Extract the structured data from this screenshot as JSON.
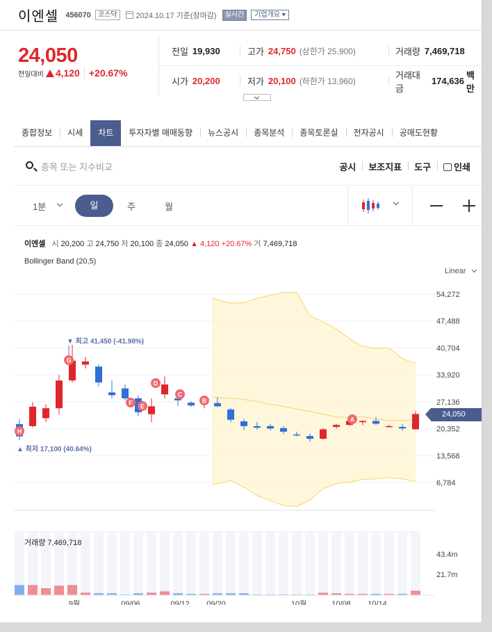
{
  "header": {
    "name": "이엔셀",
    "code": "456070",
    "market": "코스닥",
    "date": "2024.10.17 기준(장마감)",
    "realtime": "실시간",
    "company_info": "기업개요"
  },
  "summary": {
    "price": "24,050",
    "change_label": "전일대비",
    "change": "4,120",
    "change_pct": "+20.67%",
    "prev_close_label": "전일",
    "prev_close": "19,930",
    "high_label": "고가",
    "high": "24,750",
    "upper_limit": "(상한가 25,900)",
    "volume_label": "거래량",
    "volume": "7,469,718",
    "open_label": "시가",
    "open": "20,200",
    "low_label": "저가",
    "low": "20,100",
    "lower_limit": "(하한가 13,960)",
    "turnover_label": "거래대금",
    "turnover": "174,636",
    "turnover_unit": "백만"
  },
  "tabs": [
    "종합정보",
    "시세",
    "차트",
    "투자자별 매매동향",
    "뉴스공시",
    "종목분석",
    "종목토론실",
    "전자공시",
    "공매도현황"
  ],
  "active_tab": "차트",
  "search": {
    "placeholder": "종목 또는 지수비교",
    "tools": [
      "공시",
      "보조지표",
      "도구",
      "인쇄"
    ]
  },
  "periods": {
    "minute": "1분",
    "day": "일",
    "week": "주",
    "month": "월"
  },
  "legend": {
    "name": "이엔셀",
    "open_label": "시",
    "open": "20,200",
    "high_label": "고",
    "high": "24,750",
    "low_label": "저",
    "low": "20,100",
    "close_label": "종",
    "close": "24,050",
    "change": "▲ 4,120 +20.67%",
    "volume_label": "거",
    "volume": "7,469,718",
    "indicator": "Bollinger Band (20,5)",
    "scale": "Linear"
  },
  "chart_data": {
    "type": "candlestick",
    "y_ticks": [
      "54,272",
      "47,488",
      "40,704",
      "33,920",
      "27,136",
      "20,352",
      "13,568",
      "6,784"
    ],
    "x_ticks": [
      "9월",
      "09/06",
      "09/12",
      "09/20",
      "10월",
      "10/08",
      "10/14"
    ],
    "current_price": "24,050",
    "annotations": {
      "max": "▼ 최고 41,450 (-41.98%)",
      "min": "▲ 최저 17,100 (40.64%)"
    },
    "markers": [
      "A",
      "B",
      "C",
      "D",
      "E",
      "F",
      "G",
      "H"
    ],
    "volume_label": "거래량 7,469,718",
    "volume_ticks": [
      "43.4m",
      "21.7m"
    ],
    "candles": [
      {
        "o": 21500,
        "h": 22800,
        "l": 17500,
        "c": 18400
      },
      {
        "o": 21000,
        "h": 27000,
        "l": 20700,
        "c": 25900
      },
      {
        "o": 23000,
        "h": 26500,
        "l": 22000,
        "c": 25500
      },
      {
        "o": 25500,
        "h": 33900,
        "l": 24000,
        "c": 32500
      },
      {
        "o": 32500,
        "h": 41450,
        "l": 32000,
        "c": 37500
      },
      {
        "o": 36500,
        "h": 38500,
        "l": 35500,
        "c": 37300
      },
      {
        "o": 36000,
        "h": 36500,
        "l": 31000,
        "c": 32000
      },
      {
        "o": 29500,
        "h": 32500,
        "l": 28000,
        "c": 28800
      },
      {
        "o": 30500,
        "h": 31500,
        "l": 27500,
        "c": 28000
      },
      {
        "o": 28000,
        "h": 28700,
        "l": 23500,
        "c": 24500
      },
      {
        "o": 24000,
        "h": 28000,
        "l": 22000,
        "c": 26000
      },
      {
        "o": 29000,
        "h": 33500,
        "l": 28000,
        "c": 31500
      },
      {
        "o": 28000,
        "h": 28700,
        "l": 26000,
        "c": 27500
      },
      {
        "o": 26900,
        "h": 27300,
        "l": 25800,
        "c": 26200
      },
      {
        "o": 26500,
        "h": 27500,
        "l": 25500,
        "c": 26800
      },
      {
        "o": 26800,
        "h": 28300,
        "l": 25800,
        "c": 26000
      },
      {
        "o": 25200,
        "h": 25600,
        "l": 22000,
        "c": 22600
      },
      {
        "o": 22200,
        "h": 22800,
        "l": 20000,
        "c": 21000
      },
      {
        "o": 21000,
        "h": 22000,
        "l": 20100,
        "c": 20600
      },
      {
        "o": 21000,
        "h": 21600,
        "l": 19900,
        "c": 20400
      },
      {
        "o": 20500,
        "h": 21000,
        "l": 19000,
        "c": 19600
      },
      {
        "o": 18900,
        "h": 19600,
        "l": 18400,
        "c": 18700
      },
      {
        "o": 18500,
        "h": 19100,
        "l": 17100,
        "c": 17800
      },
      {
        "o": 17800,
        "h": 20500,
        "l": 17600,
        "c": 20200
      },
      {
        "o": 20800,
        "h": 21600,
        "l": 20300,
        "c": 21300
      },
      {
        "o": 21300,
        "h": 22600,
        "l": 21000,
        "c": 22300
      },
      {
        "o": 22000,
        "h": 22500,
        "l": 21200,
        "c": 22300
      },
      {
        "o": 22300,
        "h": 23300,
        "l": 21300,
        "c": 21600
      },
      {
        "o": 20800,
        "h": 21300,
        "l": 20600,
        "c": 21000
      },
      {
        "o": 20800,
        "h": 21600,
        "l": 19800,
        "c": 20400
      },
      {
        "o": 20200,
        "h": 24750,
        "l": 20100,
        "c": 24050
      }
    ],
    "volumes": [
      0.16,
      0.16,
      0.11,
      0.15,
      0.16,
      0.04,
      0.03,
      0.03,
      0.01,
      0.03,
      0.04,
      0.06,
      0.03,
      0.02,
      0.02,
      0.03,
      0.03,
      0.03,
      0.01,
      0.01,
      0.01,
      0.01,
      0.01,
      0.04,
      0.03,
      0.02,
      0.02,
      0.02,
      0.02,
      0.02,
      0.07
    ],
    "volume_unit": "43.4m = full scale fraction 0.7",
    "bollinger": {
      "upper": [
        53200,
        52000,
        52100,
        53200,
        54000,
        54700,
        54700,
        48800,
        47300,
        45500,
        43000,
        41100,
        40600,
        40700,
        38000,
        36800
      ],
      "middle": [
        28300,
        28000,
        27700,
        27200,
        26500,
        26000,
        25300,
        24700,
        24000,
        23300,
        23200,
        23400,
        22800,
        22400,
        22400,
        22500
      ],
      "lower": [
        6200,
        7300,
        5600,
        3500,
        2200,
        1000,
        700,
        2400,
        5200,
        6500,
        6900,
        7600,
        7700,
        8000,
        7700,
        7100
      ]
    }
  }
}
